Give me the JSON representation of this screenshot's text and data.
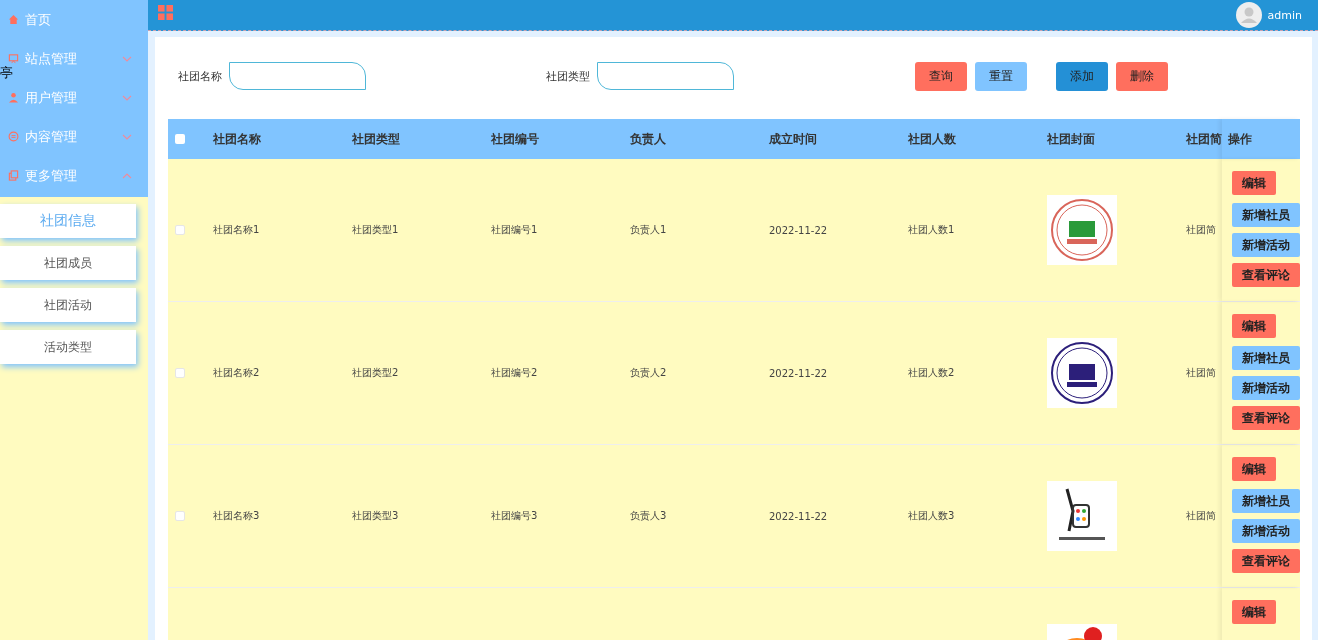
{
  "stray_char": "亭",
  "topbar": {
    "user": "admin"
  },
  "sidebar": {
    "items": [
      {
        "label": "首页",
        "kind": "link"
      },
      {
        "label": "站点管理",
        "kind": "menu",
        "expanded": false
      },
      {
        "label": "用户管理",
        "kind": "menu",
        "expanded": false
      },
      {
        "label": "内容管理",
        "kind": "menu",
        "expanded": false
      },
      {
        "label": "更多管理",
        "kind": "menu",
        "expanded": true,
        "children": [
          {
            "label": "社团信息",
            "selected": true
          },
          {
            "label": "社团成员",
            "selected": false
          },
          {
            "label": "社团活动",
            "selected": false
          },
          {
            "label": "活动类型",
            "selected": false
          }
        ]
      }
    ]
  },
  "search": {
    "fields": [
      {
        "label": "社团名称"
      },
      {
        "label": "社团类型"
      }
    ],
    "buttons": [
      {
        "label": "查询",
        "color": "#ff6f5e"
      },
      {
        "label": "重置",
        "color": "#80c4ff"
      },
      {
        "label": "添加",
        "color": "#2490d6"
      },
      {
        "label": "删除",
        "color": "#ff6f5e"
      }
    ]
  },
  "table": {
    "select_all_checked": false,
    "columns": [
      "社团名称",
      "社团类型",
      "社团编号",
      "负责人",
      "成立时间",
      "社团人数",
      "社团封面",
      "社团简",
      "操作"
    ],
    "rows": [
      {
        "checked": false,
        "cells": [
          "社团名称1",
          "社团类型1",
          "社团编号1",
          "负责人1",
          "2022-11-22",
          "社团人数1",
          "社团简"
        ],
        "cover": {
          "kind": "picture"
        },
        "actions": [
          {
            "label": "编辑",
            "color": "#ff6f5e"
          },
          {
            "label": "新增社员",
            "color": "#80c4ff"
          },
          {
            "label": "新增活动",
            "color": "#80c4ff"
          },
          {
            "label": "查看评论",
            "color": "#ff6f5e"
          }
        ]
      },
      {
        "checked": false,
        "cells": [
          "社团名称2",
          "社团类型2",
          "社团编号2",
          "负责人2",
          "2022-11-22",
          "社团人数2",
          "社团简"
        ],
        "cover": {
          "kind": "picture"
        },
        "actions": [
          {
            "label": "编辑",
            "color": "#ff6f5e"
          },
          {
            "label": "新增社员",
            "color": "#80c4ff"
          },
          {
            "label": "新增活动",
            "color": "#80c4ff"
          },
          {
            "label": "查看评论",
            "color": "#ff6f5e"
          }
        ]
      },
      {
        "checked": false,
        "cells": [
          "社团名称3",
          "社团类型3",
          "社团编号3",
          "负责人3",
          "2022-11-22",
          "社团人数3",
          "社团简"
        ],
        "cover": {
          "kind": "picture"
        },
        "actions": [
          {
            "label": "编辑",
            "color": "#ff6f5e"
          },
          {
            "label": "新增社员",
            "color": "#80c4ff"
          },
          {
            "label": "新增活动",
            "color": "#80c4ff"
          },
          {
            "label": "查看评论",
            "color": "#ff6f5e"
          }
        ]
      },
      {
        "cover": {
          "kind": "picture"
        },
        "actions": [
          {
            "label": "编辑",
            "color": "#ff6f5e"
          }
        ]
      }
    ]
  }
}
